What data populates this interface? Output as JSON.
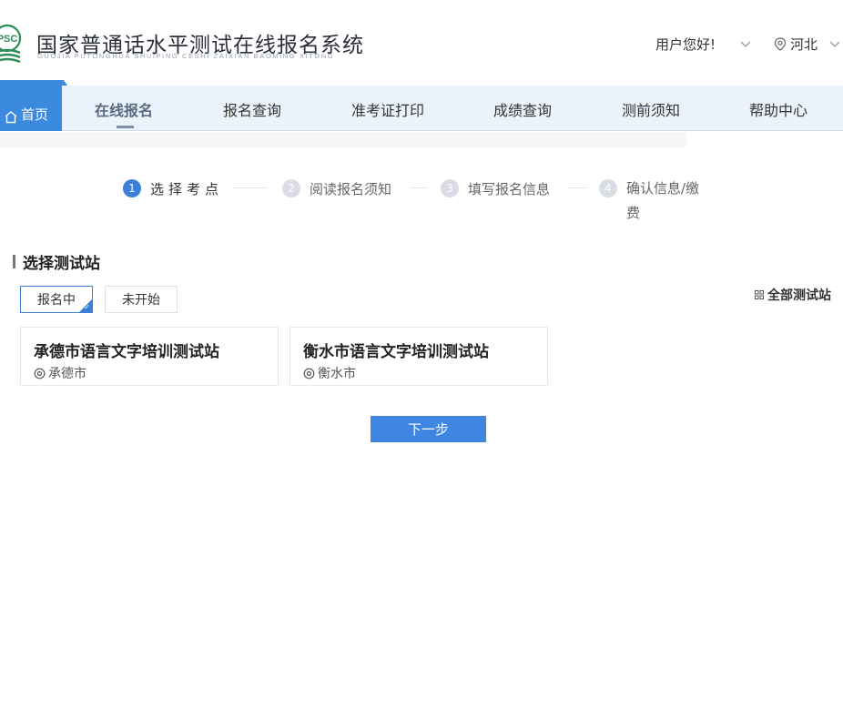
{
  "header": {
    "logo_text": "PSC",
    "title": "国家普通话水平测试在线报名系统",
    "subtitle": "GUOJIA PUTONGHUA SHUIPING CESHI ZAIXIAN BAOMING XITONG",
    "greeting": "用户您好!",
    "region": "河北"
  },
  "nav": {
    "home": "首页",
    "items": [
      "在线报名",
      "报名查询",
      "准考证打印",
      "成绩查询",
      "测前须知",
      "帮助中心"
    ],
    "active_index": 0
  },
  "steps": [
    {
      "num": "1",
      "label": "选择考点"
    },
    {
      "num": "2",
      "label": "阅读报名须知"
    },
    {
      "num": "3",
      "label": "填写报名信息"
    },
    {
      "num": "4",
      "label_line1": "确认信息/缴",
      "label_line2": "费"
    }
  ],
  "section": {
    "title": "选择测试站",
    "filters": [
      "报名中",
      "未开始"
    ],
    "all_stations": "全部测试站"
  },
  "stations": [
    {
      "name": "承德市语言文字培训测试站",
      "city": "承德市"
    },
    {
      "name": "衡水市语言文字培训测试站",
      "city": "衡水市"
    }
  ],
  "next_button": "下一步",
  "colors": {
    "primary": "#3b86e0",
    "nav_bg": "#eaf2fb"
  }
}
